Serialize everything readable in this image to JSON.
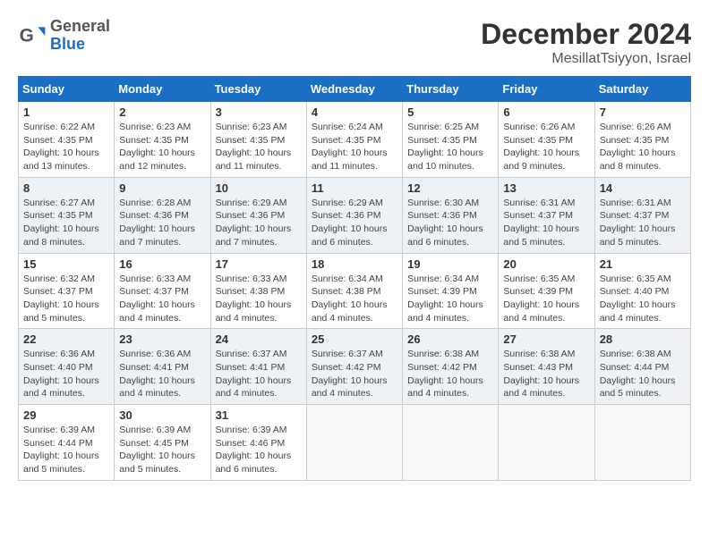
{
  "header": {
    "logo": {
      "general": "General",
      "blue": "Blue"
    },
    "title": "December 2024",
    "subtitle": "MesillatTsiyyon, Israel"
  },
  "weekdays": [
    "Sunday",
    "Monday",
    "Tuesday",
    "Wednesday",
    "Thursday",
    "Friday",
    "Saturday"
  ],
  "weeks": [
    [
      {
        "day": "1",
        "sunrise": "6:22 AM",
        "sunset": "4:35 PM",
        "daylight": "10 hours and 13 minutes."
      },
      {
        "day": "2",
        "sunrise": "6:23 AM",
        "sunset": "4:35 PM",
        "daylight": "10 hours and 12 minutes."
      },
      {
        "day": "3",
        "sunrise": "6:23 AM",
        "sunset": "4:35 PM",
        "daylight": "10 hours and 11 minutes."
      },
      {
        "day": "4",
        "sunrise": "6:24 AM",
        "sunset": "4:35 PM",
        "daylight": "10 hours and 11 minutes."
      },
      {
        "day": "5",
        "sunrise": "6:25 AM",
        "sunset": "4:35 PM",
        "daylight": "10 hours and 10 minutes."
      },
      {
        "day": "6",
        "sunrise": "6:26 AM",
        "sunset": "4:35 PM",
        "daylight": "10 hours and 9 minutes."
      },
      {
        "day": "7",
        "sunrise": "6:26 AM",
        "sunset": "4:35 PM",
        "daylight": "10 hours and 8 minutes."
      }
    ],
    [
      {
        "day": "8",
        "sunrise": "6:27 AM",
        "sunset": "4:35 PM",
        "daylight": "10 hours and 8 minutes."
      },
      {
        "day": "9",
        "sunrise": "6:28 AM",
        "sunset": "4:36 PM",
        "daylight": "10 hours and 7 minutes."
      },
      {
        "day": "10",
        "sunrise": "6:29 AM",
        "sunset": "4:36 PM",
        "daylight": "10 hours and 7 minutes."
      },
      {
        "day": "11",
        "sunrise": "6:29 AM",
        "sunset": "4:36 PM",
        "daylight": "10 hours and 6 minutes."
      },
      {
        "day": "12",
        "sunrise": "6:30 AM",
        "sunset": "4:36 PM",
        "daylight": "10 hours and 6 minutes."
      },
      {
        "day": "13",
        "sunrise": "6:31 AM",
        "sunset": "4:37 PM",
        "daylight": "10 hours and 5 minutes."
      },
      {
        "day": "14",
        "sunrise": "6:31 AM",
        "sunset": "4:37 PM",
        "daylight": "10 hours and 5 minutes."
      }
    ],
    [
      {
        "day": "15",
        "sunrise": "6:32 AM",
        "sunset": "4:37 PM",
        "daylight": "10 hours and 5 minutes."
      },
      {
        "day": "16",
        "sunrise": "6:33 AM",
        "sunset": "4:37 PM",
        "daylight": "10 hours and 4 minutes."
      },
      {
        "day": "17",
        "sunrise": "6:33 AM",
        "sunset": "4:38 PM",
        "daylight": "10 hours and 4 minutes."
      },
      {
        "day": "18",
        "sunrise": "6:34 AM",
        "sunset": "4:38 PM",
        "daylight": "10 hours and 4 minutes."
      },
      {
        "day": "19",
        "sunrise": "6:34 AM",
        "sunset": "4:39 PM",
        "daylight": "10 hours and 4 minutes."
      },
      {
        "day": "20",
        "sunrise": "6:35 AM",
        "sunset": "4:39 PM",
        "daylight": "10 hours and 4 minutes."
      },
      {
        "day": "21",
        "sunrise": "6:35 AM",
        "sunset": "4:40 PM",
        "daylight": "10 hours and 4 minutes."
      }
    ],
    [
      {
        "day": "22",
        "sunrise": "6:36 AM",
        "sunset": "4:40 PM",
        "daylight": "10 hours and 4 minutes."
      },
      {
        "day": "23",
        "sunrise": "6:36 AM",
        "sunset": "4:41 PM",
        "daylight": "10 hours and 4 minutes."
      },
      {
        "day": "24",
        "sunrise": "6:37 AM",
        "sunset": "4:41 PM",
        "daylight": "10 hours and 4 minutes."
      },
      {
        "day": "25",
        "sunrise": "6:37 AM",
        "sunset": "4:42 PM",
        "daylight": "10 hours and 4 minutes."
      },
      {
        "day": "26",
        "sunrise": "6:38 AM",
        "sunset": "4:42 PM",
        "daylight": "10 hours and 4 minutes."
      },
      {
        "day": "27",
        "sunrise": "6:38 AM",
        "sunset": "4:43 PM",
        "daylight": "10 hours and 4 minutes."
      },
      {
        "day": "28",
        "sunrise": "6:38 AM",
        "sunset": "4:44 PM",
        "daylight": "10 hours and 5 minutes."
      }
    ],
    [
      {
        "day": "29",
        "sunrise": "6:39 AM",
        "sunset": "4:44 PM",
        "daylight": "10 hours and 5 minutes."
      },
      {
        "day": "30",
        "sunrise": "6:39 AM",
        "sunset": "4:45 PM",
        "daylight": "10 hours and 5 minutes."
      },
      {
        "day": "31",
        "sunrise": "6:39 AM",
        "sunset": "4:46 PM",
        "daylight": "10 hours and 6 minutes."
      },
      null,
      null,
      null,
      null
    ]
  ],
  "labels": {
    "sunrise": "Sunrise:",
    "sunset": "Sunset:",
    "daylight": "Daylight:"
  }
}
